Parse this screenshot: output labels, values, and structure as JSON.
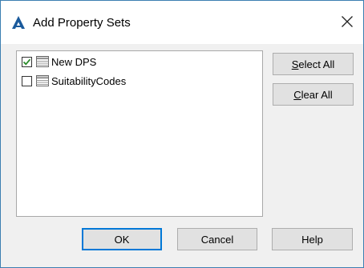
{
  "window": {
    "title": "Add Property Sets",
    "icon": "autodesk-a-icon",
    "close_icon": "close-icon"
  },
  "property_sets": {
    "items": [
      {
        "label": "New DPS",
        "checked": true,
        "icon": "table-icon"
      },
      {
        "label": "SuitabilityCodes",
        "checked": false,
        "icon": "table-icon"
      }
    ]
  },
  "buttons": {
    "select_all": {
      "mnemonic": "S",
      "rest": "elect All"
    },
    "clear_all": {
      "mnemonic": "C",
      "rest": "lear All"
    },
    "ok": "OK",
    "cancel": "Cancel",
    "help": "Help"
  },
  "colors": {
    "accent": "#0078d7",
    "check_green": "#2a8b2a",
    "border": "#3c7fb1"
  }
}
